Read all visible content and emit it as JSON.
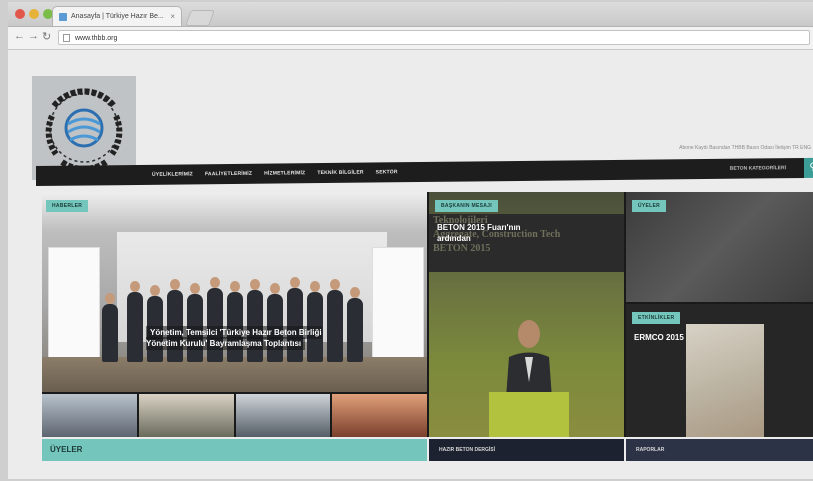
{
  "browser": {
    "tab_title": "Anasayfa | Türkiye Hazır Be...",
    "tab_close": "×",
    "url": "www.thbb.org"
  },
  "site": {
    "top_links": "Abone Kaydı   Basından THBB   Basın Odası   İletişim   TR   ENG",
    "menu": [
      "ÜYELİKLERİMİZ",
      "FAALİYETLERİMİZ",
      "HİZMETLERİMİZ",
      "TEKNİK BİLGİLER",
      "SEKTÖR"
    ],
    "categories_label": "BETON KATEGORİLERİ",
    "search_glyph": "⚲"
  },
  "featured": {
    "main": {
      "tag": "HABERLER",
      "caption": "Yönetim, Temsilci 'Türkiye Hazır Beton Birliği Yönetim Kurulu' Bayramlaşma Toplantısı"
    },
    "middle": {
      "tag": "BAŞKANIN MESAJI",
      "caption": "BETON 2015 Fuarı'nın ardından",
      "sign_text": "Teknolojileri\nAggregate, Construction Tech\nBETON 2015"
    },
    "right_top": {
      "tag": "ÜYELER"
    },
    "right_bottom": {
      "tag": "ETKİNLİKLER",
      "caption": "ERMCO 2015"
    }
  },
  "bottom_bar": {
    "members_label": "ÜYELER",
    "magazine_label": "HAZIR BETON DERGİSİ",
    "reports_label": "RAPORLAR"
  },
  "colors": {
    "accent": "#74c6bd",
    "menu_bg": "#1d1d1d"
  }
}
